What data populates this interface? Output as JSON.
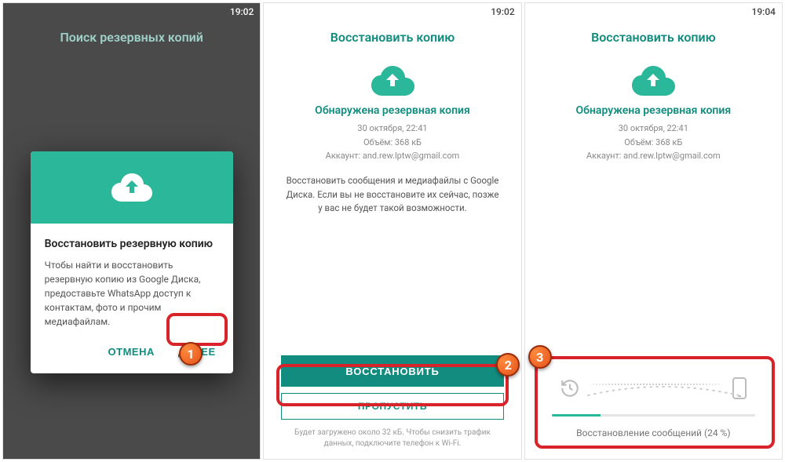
{
  "screen1": {
    "time": "19:02",
    "title": "Поиск резервных копий",
    "dialog": {
      "title": "Восстановить резервную копию",
      "text": "Чтобы найти и восстановить резервную копию из Google Диска, предоставьте WhatsApp доступ к контактам, фото и прочим медиафайлам.",
      "cancel": "ОТМЕНА",
      "next": "ДАЛЕЕ"
    },
    "badge": "1"
  },
  "screen2": {
    "time": "19:02",
    "title": "Восстановить копию",
    "found_title": "Обнаружена резервная копия",
    "meta_date": "30 октября, 22:41",
    "meta_size": "Объём: 368 кБ",
    "meta_account": "Аккаунт: and.rew.lptw@gmail.com",
    "desc": "Восстановить сообщения и медиафайлы с Google Диска. Если вы не восстановите их сейчас, позже у вас не будет такой возможности.",
    "restore": "ВОССТАНОВИТЬ",
    "skip": "ПРОПУСТИТЬ",
    "hint": "Будет загружено около 32 кБ. Чтобы снизить трафик данных, подключите телефон к Wi-Fi.",
    "badge": "2"
  },
  "screen3": {
    "time": "19:04",
    "title": "Восстановить копию",
    "found_title": "Обнаружена резервная копия",
    "meta_date": "30 октября, 22:41",
    "meta_size": "Объём: 368 кБ",
    "meta_account": "Аккаунт: and.rew.lptw@gmail.com",
    "progress_label": "Восстановление сообщений (24 %)",
    "progress_pct": 24,
    "badge": "3"
  }
}
